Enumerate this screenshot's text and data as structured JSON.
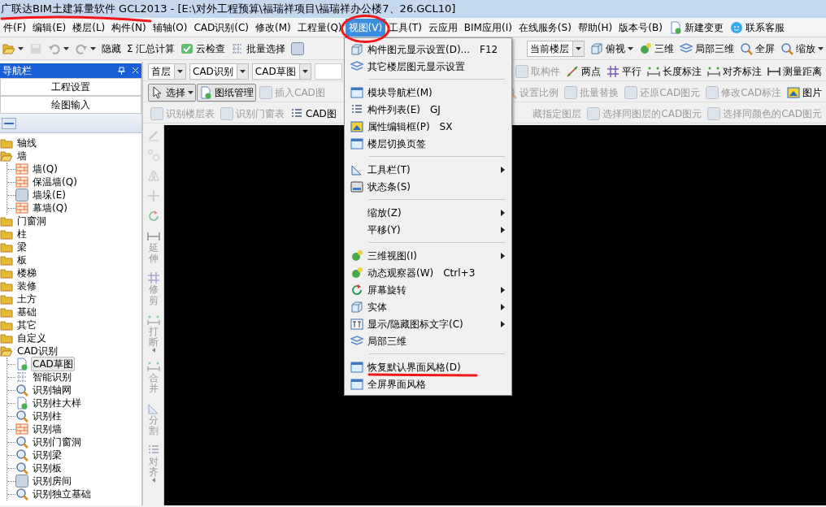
{
  "window": {
    "title": "广联达BIM土建算量软件 GCL2013 - [E:\\对外工程预算\\福瑞祥项目\\福瑞祥办公楼7、26.GCL10]"
  },
  "menu_bar": [
    {
      "label": "件(F)",
      "selected": false
    },
    {
      "label": "编辑(E)",
      "selected": false
    },
    {
      "label": "楼层(L)",
      "selected": false
    },
    {
      "label": "构件(N)",
      "selected": false
    },
    {
      "label": "辅轴(O)",
      "selected": false
    },
    {
      "label": "CAD识别(C)",
      "selected": false
    },
    {
      "label": "修改(M)",
      "selected": false
    },
    {
      "label": "工程量(Q)",
      "selected": false
    },
    {
      "label": "视图(V)",
      "selected": true
    },
    {
      "label": "工具(T)",
      "selected": false
    },
    {
      "label": "云应用",
      "selected": false
    },
    {
      "label": "BIM应用(I)",
      "selected": false
    },
    {
      "label": "在线服务(S)",
      "selected": false
    },
    {
      "label": "帮助(H)",
      "selected": false
    },
    {
      "label": "版本号(B)",
      "selected": false
    },
    {
      "label": "新建变更",
      "selected": false
    },
    {
      "label": "联系客服",
      "selected": false
    }
  ],
  "toolbar": {
    "left": [
      {
        "label": "隐藏",
        "kind": "button",
        "disabled": false,
        "pressed": false
      },
      {
        "label": "Σ 汇总计算",
        "kind": "button",
        "disabled": false,
        "pressed": false
      },
      {
        "label": "云检查",
        "kind": "button",
        "disabled": false,
        "pressed": false
      },
      {
        "label": "批量选择",
        "kind": "button",
        "disabled": false,
        "pressed": false
      }
    ],
    "right": [
      {
        "label": "当前楼层",
        "kind": "select"
      },
      {
        "label": "俯视",
        "kind": "dropdown",
        "disabled": false,
        "pressed": false
      },
      {
        "label": "三维",
        "kind": "button",
        "disabled": false,
        "pressed": false
      },
      {
        "label": "局部三维",
        "kind": "button",
        "disabled": false,
        "pressed": false
      },
      {
        "label": "全屏",
        "kind": "button",
        "disabled": false,
        "pressed": false
      },
      {
        "label": "缩放",
        "kind": "dropdown",
        "disabled": false,
        "pressed": false
      }
    ]
  },
  "navigator": {
    "title": "导航栏",
    "buttons": [
      "工程设置",
      "绘图输入"
    ],
    "tree": [
      {
        "label": "轴线",
        "kind": "folder",
        "expanded": false,
        "selected": false
      },
      {
        "label": "墙",
        "kind": "folder",
        "expanded": true,
        "selected": false,
        "children": [
          {
            "label": "墙(Q)",
            "kind": "leaf",
            "selected": false
          },
          {
            "label": "保温墙(Q)",
            "kind": "leaf",
            "selected": false
          },
          {
            "label": "墙垛(E)",
            "kind": "leaf",
            "selected": false
          },
          {
            "label": "幕墙(Q)",
            "kind": "leaf",
            "selected": false
          }
        ]
      },
      {
        "label": "门窗洞",
        "kind": "folder",
        "expanded": false,
        "selected": false
      },
      {
        "label": "柱",
        "kind": "folder",
        "expanded": false,
        "selected": false
      },
      {
        "label": "梁",
        "kind": "folder",
        "expanded": false,
        "selected": false
      },
      {
        "label": "板",
        "kind": "folder",
        "expanded": false,
        "selected": false
      },
      {
        "label": "楼梯",
        "kind": "folder",
        "expanded": false,
        "selected": false
      },
      {
        "label": "装修",
        "kind": "folder",
        "expanded": false,
        "selected": false
      },
      {
        "label": "土方",
        "kind": "folder",
        "expanded": false,
        "selected": false
      },
      {
        "label": "基础",
        "kind": "folder",
        "expanded": false,
        "selected": false
      },
      {
        "label": "其它",
        "kind": "folder",
        "expanded": false,
        "selected": false
      },
      {
        "label": "自定义",
        "kind": "folder",
        "expanded": false,
        "selected": false
      },
      {
        "label": "CAD识别",
        "kind": "folder",
        "expanded": true,
        "selected": false,
        "children": [
          {
            "label": "CAD草图",
            "kind": "leaf",
            "selected": true
          },
          {
            "label": "智能识别",
            "kind": "leaf",
            "selected": false
          },
          {
            "label": "识别轴网",
            "kind": "leaf",
            "selected": false
          },
          {
            "label": "识别柱大样",
            "kind": "leaf",
            "selected": false
          },
          {
            "label": "识别柱",
            "kind": "leaf",
            "selected": false
          },
          {
            "label": "识别墙",
            "kind": "leaf",
            "selected": false
          },
          {
            "label": "识别门窗洞",
            "kind": "leaf",
            "selected": false
          },
          {
            "label": "识别梁",
            "kind": "leaf",
            "selected": false
          },
          {
            "label": "识别板",
            "kind": "leaf",
            "selected": false
          },
          {
            "label": "识别房间",
            "kind": "leaf",
            "selected": false
          },
          {
            "label": "识别独立基础",
            "kind": "leaf",
            "selected": false
          }
        ]
      }
    ]
  },
  "drawing_toolbars": [
    {
      "left": [
        {
          "label": "首层",
          "kind": "select"
        },
        {
          "label": "CAD识别",
          "kind": "select"
        },
        {
          "label": "CAD草图",
          "kind": "select"
        },
        {
          "kind": "field"
        }
      ],
      "right": [
        {
          "label": "取构件",
          "kind": "button",
          "disabled": true,
          "pressed": false
        },
        {
          "label": "两点",
          "kind": "button",
          "disabled": false,
          "pressed": false
        },
        {
          "label": "平行",
          "kind": "button",
          "disabled": false,
          "pressed": false
        },
        {
          "label": "长度标注",
          "kind": "button",
          "disabled": false,
          "pressed": false
        },
        {
          "label": "对齐标注",
          "kind": "button",
          "disabled": false,
          "pressed": false
        },
        {
          "label": "测量距离",
          "kind": "button",
          "disabled": false,
          "pressed": false
        }
      ]
    },
    {
      "left": [
        {
          "label": "选择",
          "kind": "dropdown",
          "disabled": false,
          "pressed": true
        },
        {
          "label": "图纸管理",
          "kind": "button",
          "disabled": false,
          "pressed": true
        },
        {
          "label": "插入CAD图",
          "kind": "button",
          "disabled": true,
          "pressed": false
        }
      ],
      "right": [
        {
          "label": "设置比例",
          "kind": "button",
          "disabled": true,
          "pressed": false
        },
        {
          "label": "批量替换",
          "kind": "button",
          "disabled": true,
          "pressed": false
        },
        {
          "label": "还原CAD图元",
          "kind": "button",
          "disabled": true,
          "pressed": false
        },
        {
          "label": "修改CAD标注",
          "kind": "button",
          "disabled": true,
          "pressed": false
        },
        {
          "label": "图片",
          "kind": "button",
          "disabled": false,
          "pressed": false
        }
      ]
    },
    {
      "left": [
        {
          "label": "识别楼层表",
          "kind": "button",
          "disabled": true,
          "pressed": false
        },
        {
          "label": "识别门窗表",
          "kind": "button",
          "disabled": true,
          "pressed": false
        },
        {
          "label": "CAD图",
          "kind": "button",
          "disabled": false,
          "pressed": false
        }
      ],
      "right": [
        {
          "label": "藏指定图层",
          "kind": "button",
          "disabled": true,
          "pressed": false
        },
        {
          "label": "选择同图层的CAD图元",
          "kind": "button",
          "disabled": true,
          "pressed": false
        },
        {
          "label": "选择同颜色的CAD图元",
          "kind": "button",
          "disabled": true,
          "pressed": false
        }
      ]
    }
  ],
  "edit_tools": [
    {
      "label": "延伸",
      "disabled": true,
      "dropdown": false
    },
    {
      "label": "修剪",
      "disabled": true,
      "dropdown": false
    },
    {
      "label": "打断",
      "disabled": true,
      "dropdown": true
    },
    {
      "label": "合并",
      "disabled": true,
      "dropdown": false
    },
    {
      "label": "分割",
      "disabled": true,
      "dropdown": false
    },
    {
      "label": "对齐",
      "disabled": true,
      "dropdown": true
    }
  ],
  "view_menu": [
    {
      "kind": "item",
      "label": "构件图元显示设置(D)...",
      "shortcut": "F12",
      "submenu": false
    },
    {
      "kind": "item",
      "label": "其它楼层图元显示设置",
      "submenu": false
    },
    {
      "kind": "separator"
    },
    {
      "kind": "item",
      "label": "模块导航栏(M)",
      "submenu": false
    },
    {
      "kind": "item",
      "label": "构件列表(E)",
      "shortcut": "GJ",
      "submenu": false
    },
    {
      "kind": "item",
      "label": "属性编辑框(P)",
      "shortcut": "SX",
      "submenu": false
    },
    {
      "kind": "item",
      "label": "楼层切换页签",
      "submenu": false
    },
    {
      "kind": "separator"
    },
    {
      "kind": "item",
      "label": "工具栏(T)",
      "submenu": true
    },
    {
      "kind": "item",
      "label": "状态条(S)",
      "submenu": false
    },
    {
      "kind": "separator"
    },
    {
      "kind": "item",
      "label": "缩放(Z)",
      "submenu": true
    },
    {
      "kind": "item",
      "label": "平移(Y)",
      "submenu": true
    },
    {
      "kind": "separator"
    },
    {
      "kind": "item",
      "label": "三维视图(I)",
      "submenu": true
    },
    {
      "kind": "item",
      "label": "动态观察器(W)",
      "shortcut": "Ctrl+3",
      "submenu": false
    },
    {
      "kind": "item",
      "label": "屏幕旋转",
      "submenu": true
    },
    {
      "kind": "item",
      "label": "实体",
      "submenu": true
    },
    {
      "kind": "item",
      "label": "显示/隐藏图标文字(C)",
      "submenu": true
    },
    {
      "kind": "item",
      "label": "局部三维",
      "submenu": false
    },
    {
      "kind": "separator"
    },
    {
      "kind": "item",
      "label": "恢复默认界面风格(D)",
      "submenu": false
    },
    {
      "kind": "item",
      "label": "全屏界面风格",
      "submenu": false
    }
  ]
}
